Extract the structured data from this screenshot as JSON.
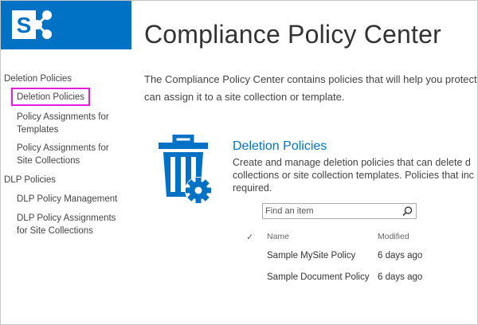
{
  "header": {
    "title": "Compliance Policy Center",
    "logo_letter": "S"
  },
  "intro": {
    "line1": "The Compliance Policy Center contains policies that will help you protect t",
    "line2": "can assign it to a site collection or template."
  },
  "sidebar": {
    "deletion_heading": "Deletion Policies",
    "deletion_items": [
      {
        "label": "Deletion Policies"
      },
      {
        "label_lines": [
          "Policy Assignments for",
          "Templates"
        ]
      },
      {
        "label_lines": [
          "Policy Assignments for",
          "Site Collections"
        ]
      }
    ],
    "dlp_heading": "DLP Policies",
    "dlp_items": [
      {
        "label": "DLP Policy Management"
      },
      {
        "label_lines": [
          "DLP Policy Assignments",
          "for Site Collections"
        ]
      }
    ]
  },
  "section": {
    "icon": "trash-gear-icon",
    "title": "Deletion Policies",
    "desc_lines": [
      "Create and manage deletion policies that can delete d",
      "collections or site collection templates. Policies that inc",
      "required."
    ]
  },
  "search": {
    "placeholder": "Find an item"
  },
  "table": {
    "columns": {
      "name": "Name",
      "modified": "Modified"
    },
    "rows": [
      {
        "name": "Sample MySite Policy",
        "modified": "6 days ago"
      },
      {
        "name": "Sample Document Policy",
        "modified": "6 days ago"
      }
    ]
  },
  "colors": {
    "brand": "#0072c6",
    "highlight": "#e01ee0"
  }
}
